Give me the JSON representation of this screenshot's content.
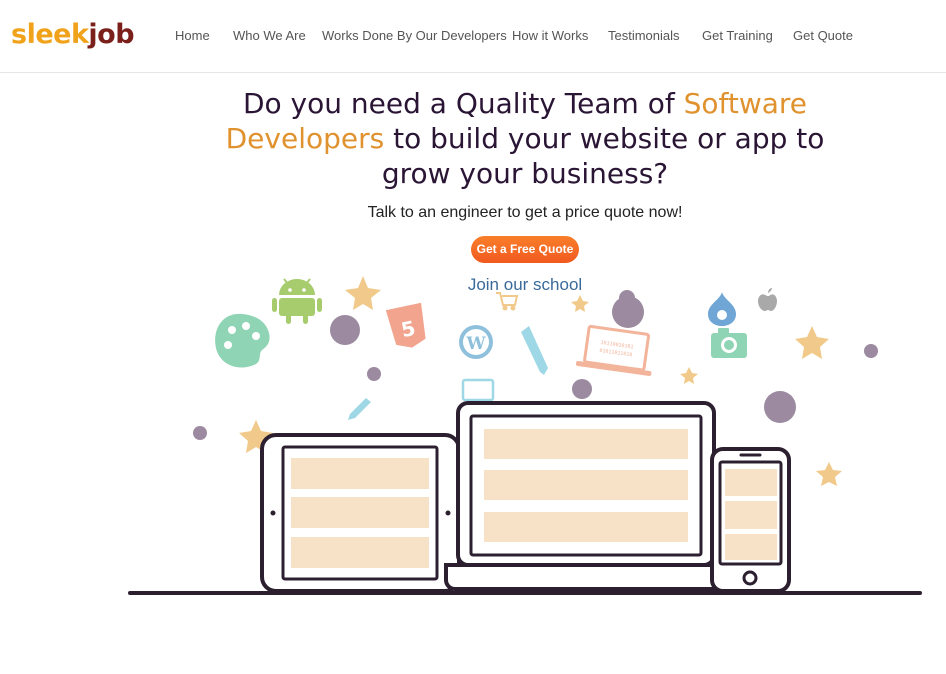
{
  "brand": {
    "logo_part1": "sleek",
    "logo_part2": "job"
  },
  "nav": {
    "items": [
      {
        "label": "Home"
      },
      {
        "label": "Who We Are"
      },
      {
        "label": "Works Done By Our Developers"
      },
      {
        "label": "How it Works"
      },
      {
        "label": "Testimonials"
      },
      {
        "label": "Get Training"
      },
      {
        "label": "Get Quote"
      }
    ]
  },
  "hero": {
    "headline_part1": "Do you need a Quality Team of ",
    "headline_accent": "Software Developers",
    "headline_part2": " to build your website or app to grow your business?",
    "subtitle": "Talk to an engineer to get a price quote now!",
    "cta_label": "Get a Free Quote",
    "school_link": "Join our school"
  },
  "illustration": {
    "icons": [
      "palette-icon",
      "android-icon",
      "star-icon",
      "html5-icon",
      "wordpress-icon",
      "pencil-icon",
      "laptop-code-icon",
      "shopping-cart-icon",
      "drupal-icon",
      "apple-icon",
      "camera-icon"
    ],
    "devices": [
      "tablet",
      "laptop",
      "phone"
    ]
  },
  "colors": {
    "accent": "#e0922e",
    "headline": "#2a1535",
    "cta_gradient_top": "#f97f2a",
    "cta_gradient_bottom": "#f1591f",
    "link": "#3a6a9a",
    "device_outline": "#2c2030",
    "screen_fill": "#f7e2c8"
  }
}
